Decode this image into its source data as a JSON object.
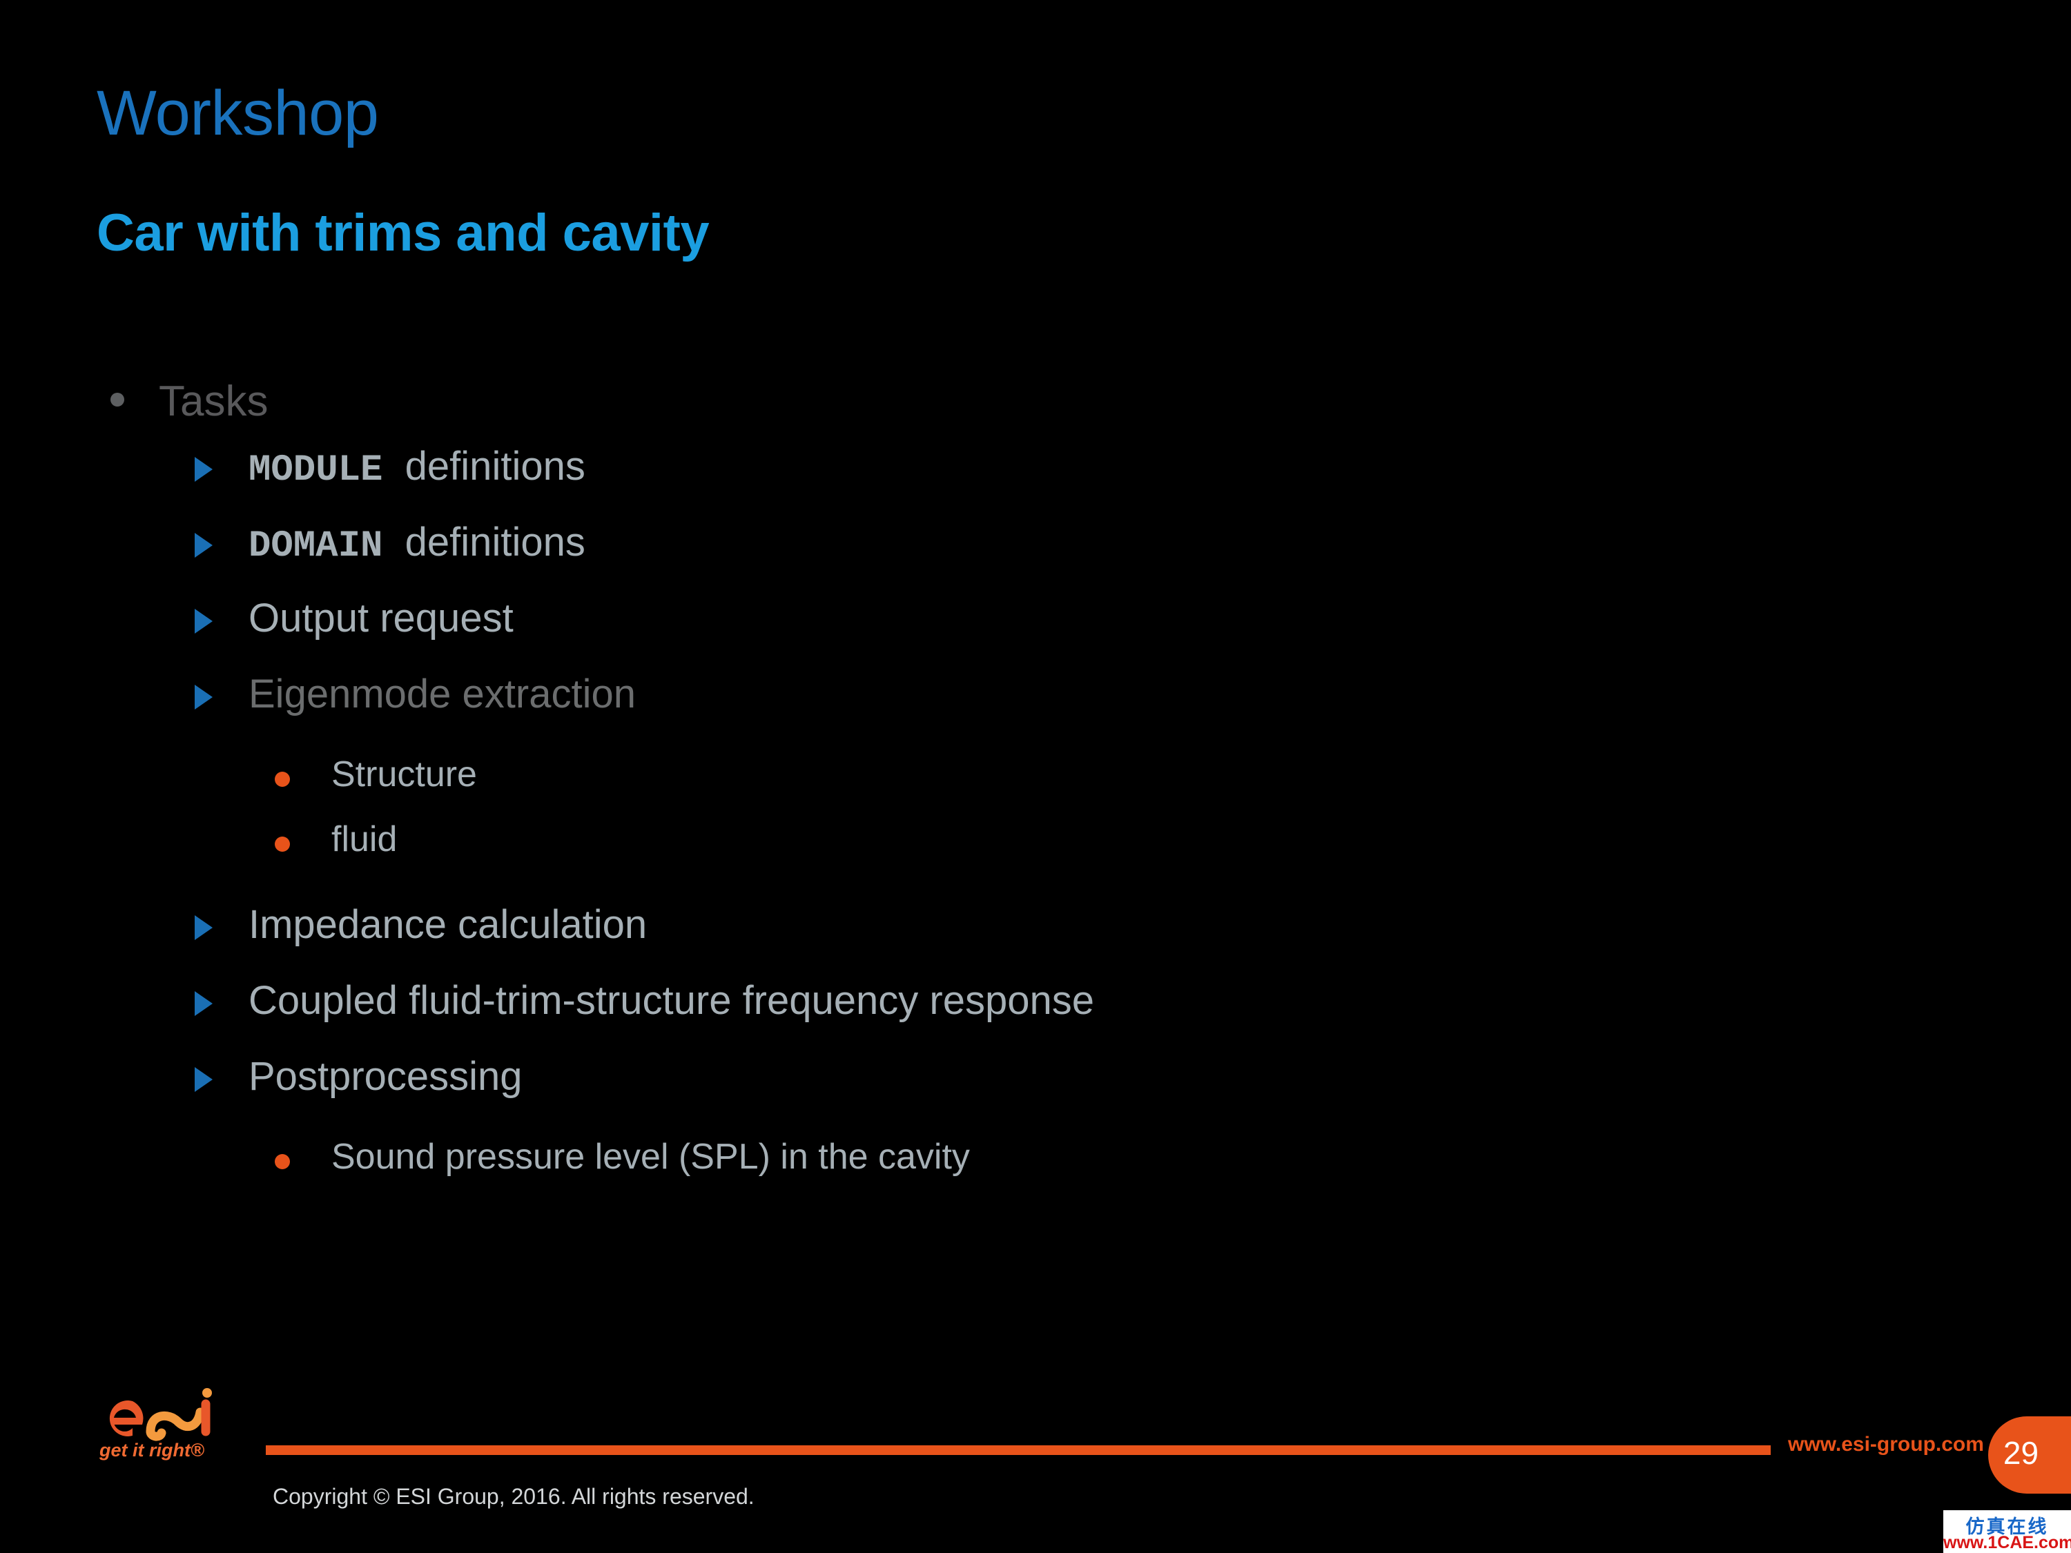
{
  "slide": {
    "title": "Workshop",
    "subtitle": "Car with trims and cavity",
    "background_color": "#000000"
  },
  "colors": {
    "title_blue": "#1a72bd",
    "subtitle_blue": "#1b9ee0",
    "arrow_blue": "#1a6fb5",
    "orange": "#e8531a",
    "logo_orange_light": "#f39a3e",
    "text_gray_light": "#a6b0b6",
    "text_gray_dark": "#59595b"
  },
  "content": {
    "tasks_label": "Tasks",
    "items": [
      {
        "level": 2,
        "keyword": "MODULE",
        "text": "definitions",
        "tone": "light"
      },
      {
        "level": 2,
        "keyword": "DOMAIN",
        "text": "definitions",
        "tone": "light"
      },
      {
        "level": 2,
        "keyword": "",
        "text": "Output request",
        "tone": "light"
      },
      {
        "level": 2,
        "keyword": "",
        "text": "Eigenmode extraction",
        "tone": "dark"
      },
      {
        "level": 3,
        "keyword": "",
        "text": "Structure",
        "tone": "light"
      },
      {
        "level": 3,
        "keyword": "",
        "text": "fluid",
        "tone": "light"
      },
      {
        "level": 2,
        "keyword": "",
        "text": "Impedance calculation",
        "tone": "light"
      },
      {
        "level": 2,
        "keyword": "",
        "text": "Coupled fluid-trim-structure frequency response",
        "tone": "light"
      },
      {
        "level": 2,
        "keyword": "",
        "text": "Postprocessing",
        "tone": "light"
      },
      {
        "level": 3,
        "keyword": "",
        "text": "Sound pressure level (SPL) in the cavity",
        "tone": "light"
      }
    ]
  },
  "footer": {
    "logo_wordmark": "esi",
    "logo_tagline": "get it right®",
    "url": "www.esi-group.com",
    "page_number": "29",
    "copyright": "Copyright © ESI Group, 2016. All rights reserved."
  },
  "watermark": {
    "chinese": "仿真在线",
    "english": "www.1CAE.com"
  }
}
